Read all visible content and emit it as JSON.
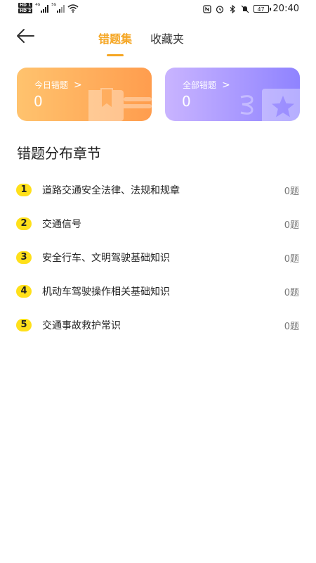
{
  "status_bar": {
    "sim1": "HD 1",
    "sim2": "HD 2",
    "net1": "4G",
    "net2": "5G",
    "battery": "47",
    "time": "20:40"
  },
  "nav": {
    "tabs": [
      {
        "label": "错题集",
        "active": true
      },
      {
        "label": "收藏夹",
        "active": false
      }
    ]
  },
  "cards": {
    "today": {
      "title": "今日错题",
      "count": "0",
      "color_from": "#ffc36e",
      "color_to": "#ff9d4e"
    },
    "all": {
      "title": "全部错题",
      "count": "0",
      "color_from": "#c9b4ff",
      "color_to": "#8f83ff"
    }
  },
  "section": {
    "title": "错题分布章节",
    "chapters": [
      {
        "num": "1",
        "label": "道路交通安全法律、法规和规章",
        "count": "0题"
      },
      {
        "num": "2",
        "label": "交通信号",
        "count": "0题"
      },
      {
        "num": "3",
        "label": "安全行车、文明驾驶基础知识",
        "count": "0题"
      },
      {
        "num": "4",
        "label": "机动车驾驶操作相关基础知识",
        "count": "0题"
      },
      {
        "num": "5",
        "label": "交通事故救护常识",
        "count": "0题"
      }
    ]
  },
  "colors": {
    "accent": "#f5a623",
    "badge": "#ffe01a"
  }
}
